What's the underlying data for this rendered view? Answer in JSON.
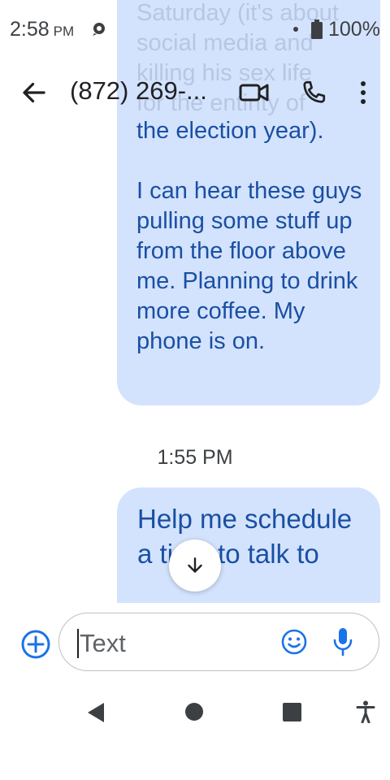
{
  "status_bar": {
    "time": "2:58",
    "ampm": "PM",
    "battery": "100%",
    "icons": [
      "notification-icon",
      "signal-dot-icon",
      "battery-icon"
    ]
  },
  "app_bar": {
    "title": "(872) 269-...",
    "icons": [
      "back-arrow-icon",
      "video-call-icon",
      "phone-icon",
      "more-vert-icon"
    ]
  },
  "messages": [
    {
      "faded_lines": [
        "Saturday (it's about",
        "social media and",
        "killing his sex life",
        "for the entirity of"
      ],
      "paragraphs": [
        "the election year).",
        "I can hear these guys pulling some stuff up from the floor above me. Planning to drink more coffee. My phone is on."
      ]
    },
    {
      "timestamp": "1:55 PM",
      "text": "Help me schedule a time to talk to"
    }
  ],
  "compose": {
    "placeholder": "Text",
    "icons": [
      "add-circle-icon",
      "emoji-icon",
      "mic-icon"
    ]
  },
  "nav_bar": {
    "icons": [
      "nav-back-icon",
      "nav-home-icon",
      "nav-recents-icon",
      "accessibility-icon"
    ]
  },
  "colors": {
    "bubble": "#d3e3fd",
    "bubble_text": "#1a4fa3",
    "accent": "#1a73e8"
  }
}
